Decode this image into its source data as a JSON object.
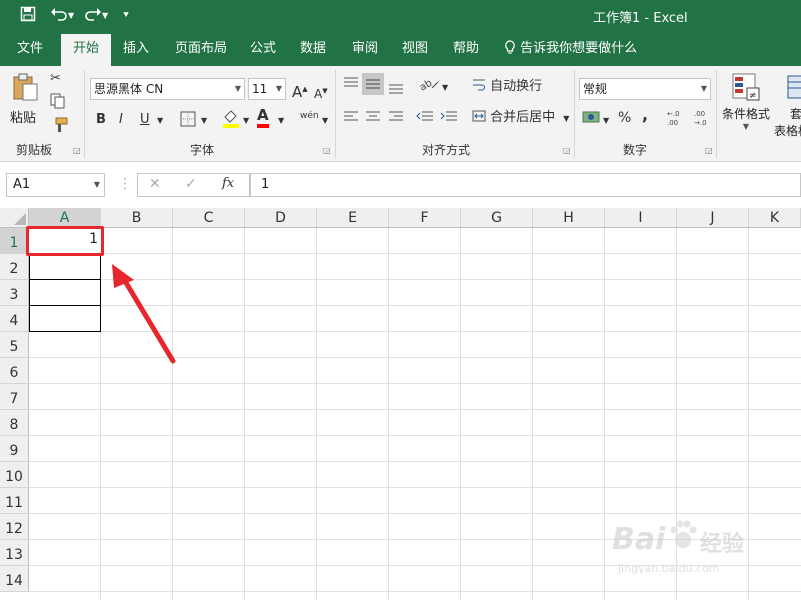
{
  "title_bar": {
    "title": "工作簿1  -   Excel"
  },
  "quick_access": [
    "save-icon",
    "undo-icon",
    "redo-icon",
    "customize-icon"
  ],
  "tabs": [
    "文件",
    "开始",
    "插入",
    "页面布局",
    "公式",
    "数据",
    "审阅",
    "视图",
    "帮助"
  ],
  "active_tab": "开始",
  "tell_me": "告诉我你想要做什么",
  "ribbon": {
    "clipboard": {
      "paste": "粘贴",
      "group": "剪贴板"
    },
    "font": {
      "name": "思源黑体 CN",
      "size": "11",
      "group": "字体",
      "bold": "B",
      "italic": "I",
      "underline": "U",
      "grow": "A",
      "shrink": "A",
      "phonetic": "wén",
      "font_color": "A"
    },
    "alignment": {
      "wrap": "自动换行",
      "merge": "合并后居中",
      "group": "对齐方式"
    },
    "number": {
      "format": "常规",
      "group": "数字",
      "percent": "%",
      "comma": ",",
      "inc_decimal": ".0→.00",
      "dec_decimal": ".00→.0"
    },
    "styles": {
      "conditional": "条件格式",
      "table_format_1": "套",
      "table_format_2": "表格格"
    }
  },
  "formula_bar": {
    "name_box": "A1",
    "fx": "fx",
    "value": "1"
  },
  "columns": [
    "A",
    "B",
    "C",
    "D",
    "E",
    "F",
    "G",
    "H",
    "I",
    "J",
    "K"
  ],
  "rows": [
    "1",
    "2",
    "3",
    "4",
    "5",
    "6",
    "7",
    "8",
    "9",
    "10",
    "11",
    "12",
    "13",
    "14"
  ],
  "cells": {
    "A1": "1"
  },
  "colors": {
    "excel_green": "#217346",
    "highlight_red": "#e8262d",
    "font_color_red": "#ff0000",
    "fill_yellow": "#ffff00"
  },
  "watermark": {
    "text_1": "Bai",
    "text_2": "经验",
    "text_3": "jingyan.baidu.com"
  }
}
